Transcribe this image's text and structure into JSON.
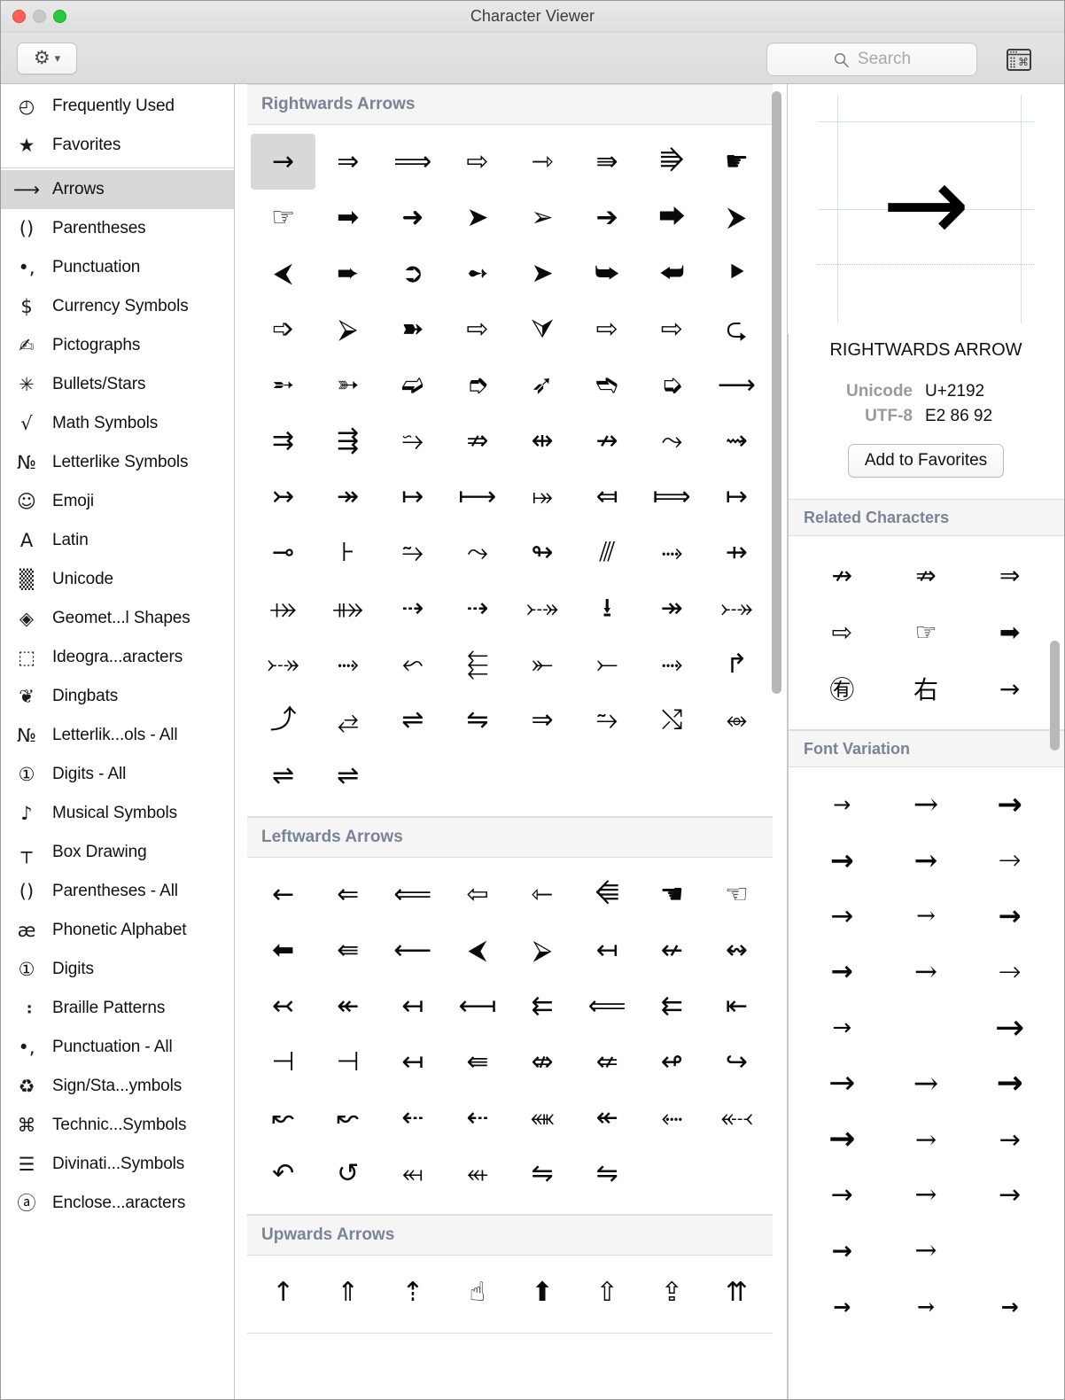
{
  "window": {
    "title": "Character Viewer",
    "traffic_lights": [
      "close",
      "minimize",
      "zoom"
    ]
  },
  "toolbar": {
    "gear_label": "⚙",
    "gear_chevron": "⌄",
    "search_placeholder": "Search",
    "search_value": "",
    "keyboard_button_label": "keyboard-viewer"
  },
  "sidebar": {
    "items": [
      {
        "icon": "ὕ2",
        "glyph": "◴",
        "label": "Frequently Used",
        "selected": false
      },
      {
        "glyph": "★",
        "label": "Favorites",
        "selected": false
      },
      {
        "glyph": "⟶",
        "label": "Arrows",
        "selected": true
      },
      {
        "glyph": "()",
        "label": "Parentheses",
        "selected": false
      },
      {
        "glyph": "•,",
        "label": "Punctuation",
        "selected": false
      },
      {
        "glyph": "$",
        "label": "Currency Symbols",
        "selected": false
      },
      {
        "glyph": "✍",
        "label": "Pictographs",
        "selected": false
      },
      {
        "glyph": "✳",
        "label": "Bullets/Stars",
        "selected": false
      },
      {
        "glyph": "√",
        "label": "Math Symbols",
        "selected": false
      },
      {
        "glyph": "№",
        "label": "Letterlike Symbols",
        "selected": false
      },
      {
        "glyph": "☺",
        "label": "Emoji",
        "selected": false
      },
      {
        "glyph": "A",
        "label": "Latin",
        "selected": false
      },
      {
        "glyph": "▒",
        "label": "Unicode",
        "selected": false
      },
      {
        "glyph": "◈",
        "label": "Geomet...l Shapes",
        "selected": false
      },
      {
        "glyph": "⬚",
        "label": "Ideogra...aracters",
        "selected": false
      },
      {
        "glyph": "❦",
        "label": "Dingbats",
        "selected": false
      },
      {
        "glyph": "№",
        "label": "Letterlik...ols - All",
        "selected": false
      },
      {
        "glyph": "①",
        "label": "Digits - All",
        "selected": false
      },
      {
        "glyph": "♪",
        "label": "Musical Symbols",
        "selected": false
      },
      {
        "glyph": "┬",
        "label": "Box Drawing",
        "selected": false
      },
      {
        "glyph": "()",
        "label": "Parentheses - All",
        "selected": false
      },
      {
        "glyph": "æ",
        "label": "Phonetic Alphabet",
        "selected": false
      },
      {
        "glyph": "①",
        "label": "Digits",
        "selected": false
      },
      {
        "glyph": "⠰",
        "label": "Braille Patterns",
        "selected": false
      },
      {
        "glyph": "•,",
        "label": "Punctuation - All",
        "selected": false
      },
      {
        "glyph": "♻",
        "label": "Sign/Sta...ymbols",
        "selected": false
      },
      {
        "glyph": "⌘",
        "label": "Technic...Symbols",
        "selected": false
      },
      {
        "glyph": "☰",
        "label": "Divinati...Symbols",
        "selected": false
      },
      {
        "glyph": "ⓐ",
        "label": "Enclose...aracters",
        "selected": false
      }
    ],
    "separator_after_index": 1
  },
  "main": {
    "groups": [
      {
        "title": "Rightwards Arrows",
        "chars": [
          "→",
          "⇒",
          "⟹",
          "⇨",
          "⇾",
          "⇛",
          "⭆",
          "☛",
          "☞",
          "➡",
          "➜",
          "➤",
          "➢",
          "➔",
          "⮕",
          "⮞",
          "⮜",
          "➨",
          "➲",
          "➻",
          "➤",
          "⮩",
          "⮨",
          "⯈",
          "➩",
          "⮚",
          "➽",
          "⇨",
          "⮛",
          "⇨",
          "⇨",
          "⮎",
          "➵",
          "➳",
          "➫",
          "➮",
          "➶",
          "➬",
          "➭",
          "⟶",
          "⇉",
          "⇶",
          "⭇",
          "⇏",
          "⇹",
          "↛",
          "⤳",
          "⇝",
          "↣",
          "↠",
          "↦",
          "⟼",
          "⤅",
          "⤆",
          "⟾",
          "↦",
          "⊸",
          "⊦",
          "⥲",
          "⤳",
          "↬",
          "⫻",
          "⤑",
          "⇸",
          "⤀",
          "⤁",
          "⇢",
          "⇢",
          "⤐",
          "⭳",
          "↠",
          "⤐",
          "⤐",
          "⤑",
          "⬿",
          "⬱",
          "⤜",
          "⤚",
          "⤑",
          "↱",
          "⤴",
          "⥄",
          "⇌",
          "⇋",
          "⇒",
          "⥲",
          "⤭",
          "⥈",
          "⇌",
          "⇌"
        ],
        "selected_index": 0
      },
      {
        "title": "Leftwards Arrows",
        "chars": [
          "←",
          "⇐",
          "⟸",
          "⇦",
          "⇽",
          "⭅",
          "☚",
          "☜",
          "⬅",
          "⇚",
          "⟵",
          "⮜",
          "⮚",
          "↤",
          "↚",
          "↭",
          "↢",
          "↞",
          "↤",
          "⟻",
          "⇇",
          "⟸",
          "⇇",
          "⇤",
          "⊣",
          "⊣",
          "↤",
          "⇚",
          "⇎",
          "⇍",
          "↫",
          "↪",
          "↜",
          "↜",
          "⇠",
          "⇠",
          "⬽",
          "↞",
          "⬸",
          "⬷",
          "↶",
          "↺",
          "⬶",
          "⬴",
          "⇋",
          "⇋"
        ],
        "selected_index": -1
      },
      {
        "title": "Upwards Arrows",
        "chars": [
          "↑",
          "⇑",
          "⇡",
          "☝",
          "⬆",
          "⇧",
          "⇪",
          "⇈"
        ],
        "selected_index": -1
      }
    ]
  },
  "inspector": {
    "preview_char": "→",
    "char_name": "RIGHTWARDS ARROW",
    "meta": [
      {
        "key": "Unicode",
        "value": "U+2192"
      },
      {
        "key": "UTF-8",
        "value": "E2 86 92"
      }
    ],
    "add_favorite_label": "Add to Favorites",
    "related_title": "Related Characters",
    "related_chars": [
      "↛",
      "⇏",
      "⇒",
      "⇨",
      "☞",
      "➡",
      "㊒",
      "右",
      "→"
    ],
    "font_variation_title": "Font Variation",
    "font_variations": [
      {
        "char": "→",
        "size": 24,
        "weight": 400
      },
      {
        "char": "→",
        "size": 34,
        "weight": 400
      },
      {
        "char": "→",
        "size": 34,
        "weight": 900
      },
      {
        "char": "→",
        "size": 32,
        "weight": 900
      },
      {
        "char": "→",
        "size": 32,
        "weight": 600
      },
      {
        "char": "→",
        "size": 31,
        "weight": 300
      },
      {
        "char": "→",
        "size": 31,
        "weight": 400
      },
      {
        "char": "→",
        "size": 26,
        "weight": 400
      },
      {
        "char": "→",
        "size": 31,
        "weight": 800
      },
      {
        "char": "→",
        "size": 30,
        "weight": 800
      },
      {
        "char": "→",
        "size": 31,
        "weight": 300
      },
      {
        "char": "→",
        "size": 31,
        "weight": 300
      },
      {
        "char": "→",
        "size": 26,
        "weight": 400
      },
      {
        "char": "",
        "size": 26,
        "weight": 400
      },
      {
        "char": "→",
        "size": 40,
        "weight": 400
      },
      {
        "char": "→",
        "size": 36,
        "weight": 500
      },
      {
        "char": "→",
        "size": 34,
        "weight": 400
      },
      {
        "char": "→",
        "size": 36,
        "weight": 900
      },
      {
        "char": "→",
        "size": 36,
        "weight": 900
      },
      {
        "char": "→",
        "size": 29,
        "weight": 400
      },
      {
        "char": "→",
        "size": 29,
        "weight": 400
      },
      {
        "char": "→",
        "size": 30,
        "weight": 500
      },
      {
        "char": "→",
        "size": 30,
        "weight": 500
      },
      {
        "char": "→",
        "size": 30,
        "weight": 400
      },
      {
        "char": "→",
        "size": 28,
        "weight": 800
      },
      {
        "char": "→",
        "size": 30,
        "weight": 300
      },
      {
        "char": "",
        "size": 26,
        "weight": 400
      },
      {
        "char": "→",
        "size": 24,
        "weight": 700
      },
      {
        "char": "→",
        "size": 24,
        "weight": 700
      },
      {
        "char": "→",
        "size": 24,
        "weight": 700
      }
    ]
  },
  "colors": {
    "selection": "#d8d8d8",
    "group_header_text": "#7b8494",
    "meta_key": "#9a9a9a",
    "guide_blue": "#cfe0f7",
    "titlebar": "#e4e4e4"
  }
}
